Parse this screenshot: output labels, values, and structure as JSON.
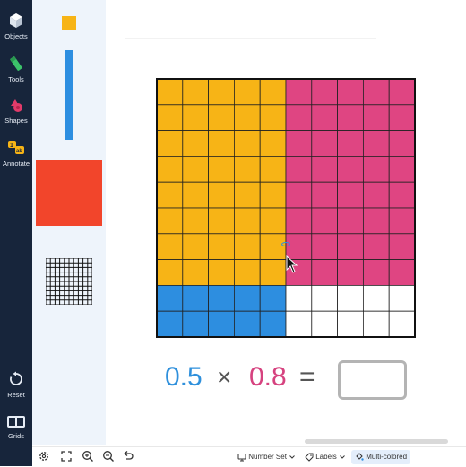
{
  "nav": {
    "objects": "Objects",
    "tools": "Tools",
    "shapes": "Shapes",
    "annotate": "Annotate",
    "reset": "Reset",
    "grids": "Grids"
  },
  "palette": {
    "items": [
      "one-block",
      "tenth-rod",
      "hundred-flat",
      "hundredths-grid"
    ]
  },
  "grid": {
    "rows": 10,
    "cols": 10,
    "shaded_rows": 8,
    "shaded_cols": 5,
    "colors": {
      "overlap": "#f7b416",
      "row_only": "#df4582",
      "col_only": "#2d8ee0",
      "empty": "#ffffff",
      "line": "#222222"
    }
  },
  "equation": {
    "a": "0.5",
    "times": "×",
    "b": "0.8",
    "equals": "=",
    "answer": ""
  },
  "toolbar": {
    "number_set": "Number Set",
    "labels": "Labels",
    "multicolored": "Multi-colored"
  }
}
